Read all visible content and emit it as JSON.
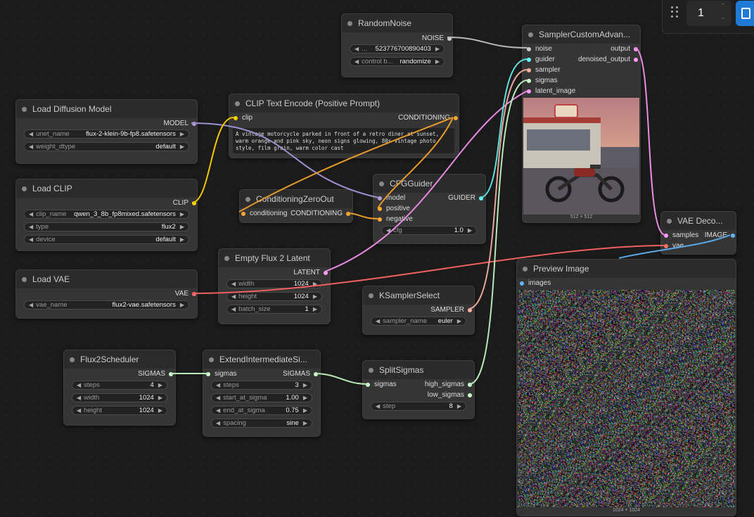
{
  "toolbar": {
    "count": "1"
  },
  "nodes": {
    "random_noise": {
      "title": "RandomNoise",
      "out": "NOISE",
      "seed_label": "...",
      "seed_value": "523776700890403",
      "control_label": "control b...",
      "control_value": "randomize"
    },
    "load_diffusion": {
      "title": "Load Diffusion Model",
      "out": "MODEL",
      "w1_label": "unet_name",
      "w1_value": "flux-2-klein-9b-fp8.safetensors",
      "w2_label": "weight_dtype",
      "w2_value": "default"
    },
    "load_clip": {
      "title": "Load CLIP",
      "out": "CLIP",
      "w1_label": "clip_name",
      "w1_value": "qwen_3_8b_fp8mixed.safetensors",
      "w2_label": "type",
      "w2_value": "flux2",
      "w3_label": "device",
      "w3_value": "default"
    },
    "load_vae": {
      "title": "Load VAE",
      "out": "VAE",
      "w1_label": "vae_name",
      "w1_value": "flux2-vae.safetensors"
    },
    "clip_text": {
      "title": "CLIP Text Encode (Positive Prompt)",
      "in": "clip",
      "out": "CONDITIONING",
      "prompt": "A vintage motorcycle parked in front of a retro diner at sunset, warm orange and pink sky, neon signs glowing, 80s vintage photo style, film grain, warm color cast"
    },
    "cond_zero": {
      "title": "ConditioningZeroOut",
      "in": "conditioning",
      "out": "CONDITIONING"
    },
    "cfg_guider": {
      "title": "CFGGuider",
      "in1": "model",
      "in2": "positive",
      "in3": "negative",
      "out": "GUIDER",
      "w1_label": "cfg",
      "w1_value": "1.0"
    },
    "empty_latent": {
      "title": "Empty Flux 2 Latent",
      "out": "LATENT",
      "w1_label": "width",
      "w1_value": "1024",
      "w2_label": "height",
      "w2_value": "1024",
      "w3_label": "batch_size",
      "w3_value": "1"
    },
    "sampler_custom": {
      "title": "SamplerCustomAdvan...",
      "in1": "noise",
      "in2": "guider",
      "in3": "sampler",
      "in4": "sigmas",
      "in5": "latent_image",
      "out1": "output",
      "out2": "denoised_output",
      "caption": "512 × 512"
    },
    "ksampler_select": {
      "title": "KSamplerSelect",
      "out": "SAMPLER",
      "w1_label": "sampler_name",
      "w1_value": "euler"
    },
    "vae_decode": {
      "title": "VAE Deco...",
      "in1": "samples",
      "in2": "vae",
      "out": "IMAGE"
    },
    "preview": {
      "title": "Preview Image",
      "in": "images",
      "caption": "1024 × 1024"
    },
    "flux2_sched": {
      "title": "Flux2Scheduler",
      "out": "SIGMAS",
      "w1_label": "steps",
      "w1_value": "4",
      "w2_label": "width",
      "w2_value": "1024",
      "w3_label": "height",
      "w3_value": "1024"
    },
    "extend_sigmas": {
      "title": "ExtendIntermediateSi...",
      "in": "sigmas",
      "out": "SIGMAS",
      "w1_label": "steps",
      "w1_value": "3",
      "w2_label": "start_at_sigma",
      "w2_value": "1.00",
      "w3_label": "end_at_sigma",
      "w3_value": "0.75",
      "w4_label": "spacing",
      "w4_value": "sine"
    },
    "split_sigmas": {
      "title": "SplitSigmas",
      "in": "sigmas",
      "out1": "high_sigmas",
      "out2": "low_sigmas",
      "w1_label": "step",
      "w1_value": "8"
    }
  },
  "colors": {
    "model": "#b39ddb",
    "clip": "#ffd500",
    "vae": "#ff6e6e",
    "conditioning": "#ffa931",
    "latent": "#ff9cf9",
    "sigmas": "#cdffcd",
    "guider": "#66ffff",
    "sampler": "#ffb0a0",
    "noise": "#cccccc",
    "image": "#64b5f6"
  }
}
